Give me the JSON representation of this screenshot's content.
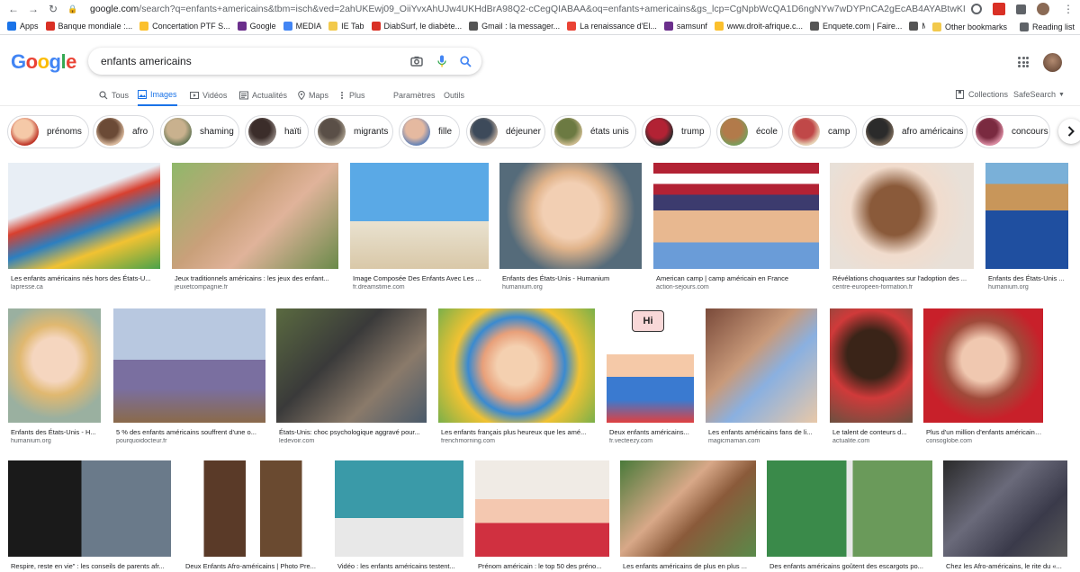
{
  "browser": {
    "url_host": "google.com",
    "url_rest": "/search?q=enfants+americains&tbm=isch&ved=2ahUKEwj09_OiiYvxAhUJw4UKHdBrA98Q2-cCegQIABAA&oq=enfants+americains&gs_lcp=CgNpbWcQA1D6ngNYw7wDYPnCA2gEcAB4AYABtwKIAdwVkgEIMC4xMy4xLjGYAQCgAQGqAQ",
    "bookmarks": [
      "Apps",
      "Banque mondiale :...",
      "Concertation PTF S...",
      "Google",
      "MEDIA",
      "IE Tab",
      "DiabSurf, le diabète...",
      "Gmail : la messager...",
      "La renaissance d'El...",
      "samsunf",
      "www.droit-afrique.c...",
      "Enquete.com | Faire...",
      "Media"
    ],
    "bookmarks_right": [
      "Other bookmarks",
      "Reading list"
    ]
  },
  "search": {
    "query": "enfants americains"
  },
  "tabs": [
    "Tous",
    "Images",
    "Vidéos",
    "Actualités",
    "Maps",
    "Plus"
  ],
  "settings_label": "Paramètres",
  "tools_label": "Outils",
  "collections_label": "Collections",
  "safesearch_label": "SafeSearch",
  "chips": [
    "prénoms",
    "afro",
    "shaming",
    "haïti",
    "migrants",
    "fille",
    "déjeuner",
    "états unis",
    "trump",
    "école",
    "camp",
    "afro américains",
    "concours"
  ],
  "row1": [
    {
      "caption": "Les enfants américains nés hors des États-U...",
      "source": "lapresse.ca"
    },
    {
      "caption": "Jeux traditionnels américains : les jeux des enfant...",
      "source": "jeuxetcompagnie.fr"
    },
    {
      "caption": "Image Composée Des Enfants Avec Les ...",
      "source": "fr.dreamstime.com"
    },
    {
      "caption": "Enfants des États-Unis - Humanium",
      "source": "humanium.org"
    },
    {
      "caption": "American camp | camp américain en France",
      "source": "action-sejours.com"
    },
    {
      "caption": "Révélations choquantes sur l'adoption des ...",
      "source": "centre-europeen-formation.fr"
    },
    {
      "caption": "Enfants des États-Unis ...",
      "source": "humanium.org"
    }
  ],
  "row2": [
    {
      "caption": "Enfants des États-Unis - H...",
      "source": "humanium.org"
    },
    {
      "caption": "5 % des enfants américains souffrent d'une o...",
      "source": "pourquoidocteur.fr"
    },
    {
      "caption": "États-Unis: choc psychologique aggravé pour...",
      "source": "ledevoir.com"
    },
    {
      "caption": "Les enfants français plus heureux que les amé...",
      "source": "frenchmorning.com"
    },
    {
      "caption": "Deux enfants américains...",
      "source": "fr.vecteezy.com"
    },
    {
      "caption": "Les enfants américains fans de li...",
      "source": "magicmaman.com"
    },
    {
      "caption": "Le talent de conteurs d...",
      "source": "actualite.com"
    },
    {
      "caption": "Plus d'un million d'enfants américains âgé...",
      "source": "consoglobe.com"
    }
  ],
  "row3": [
    {
      "caption": "Respire, reste en vie\" : les conseils de parents afr..."
    },
    {
      "caption": "Deux Enfants Afro-américains | Photo Pre..."
    },
    {
      "caption": "Vidéo : les enfants américains testent..."
    },
    {
      "caption": "Prénom américain : le top 50 des préno..."
    },
    {
      "caption": "Les enfants américains de plus en plus ..."
    },
    {
      "caption": "Des enfants américains goûtent des escargots po..."
    },
    {
      "caption": "Chez les Afro-américains, le rite du «..."
    }
  ],
  "vecteezy_bubble": "Hi",
  "colors": {
    "link_blue": "#1a73e8",
    "chip_border": "#dadce0",
    "text_grey": "#5f6368"
  }
}
